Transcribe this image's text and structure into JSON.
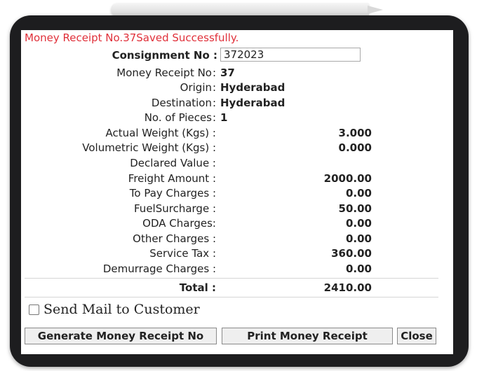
{
  "message": "Money Receipt No.37Saved Successfully.",
  "consignment": {
    "label": "Consignment No :",
    "value": "372023"
  },
  "details": [
    {
      "label": "Money Receipt No",
      "value": "37"
    },
    {
      "label": "Origin",
      "value": "Hyderabad"
    },
    {
      "label": "Destination",
      "value": "Hyderabad"
    },
    {
      "label": "No. of Pieces",
      "value": "1"
    }
  ],
  "charges": [
    {
      "label": "Actual Weight (Kgs) :",
      "value": "3.000"
    },
    {
      "label": "Volumetric Weight (Kgs) :",
      "value": "0.000"
    },
    {
      "label": "Declared Value :",
      "value": ""
    },
    {
      "label": "Freight Amount :",
      "value": "2000.00"
    },
    {
      "label": "To Pay Charges :",
      "value": "0.00"
    },
    {
      "label": "FuelSurcharge :",
      "value": "50.00"
    },
    {
      "label": "ODA Charges:",
      "value": "0.00"
    },
    {
      "label": "Other Charges :",
      "value": "0.00"
    },
    {
      "label": "Service Tax :",
      "value": "360.00"
    },
    {
      "label": "Demurrage Charges :",
      "value": "0.00"
    }
  ],
  "total": {
    "label": "Total :",
    "value": "2410.00"
  },
  "send_mail_label": "Send Mail to Customer",
  "buttons": {
    "generate": "Generate Money Receipt No",
    "print": "Print Money Receipt",
    "close": "Close"
  },
  "colors": {
    "success_message": "#e0303a",
    "device_bezel": "#1d1d1f"
  }
}
